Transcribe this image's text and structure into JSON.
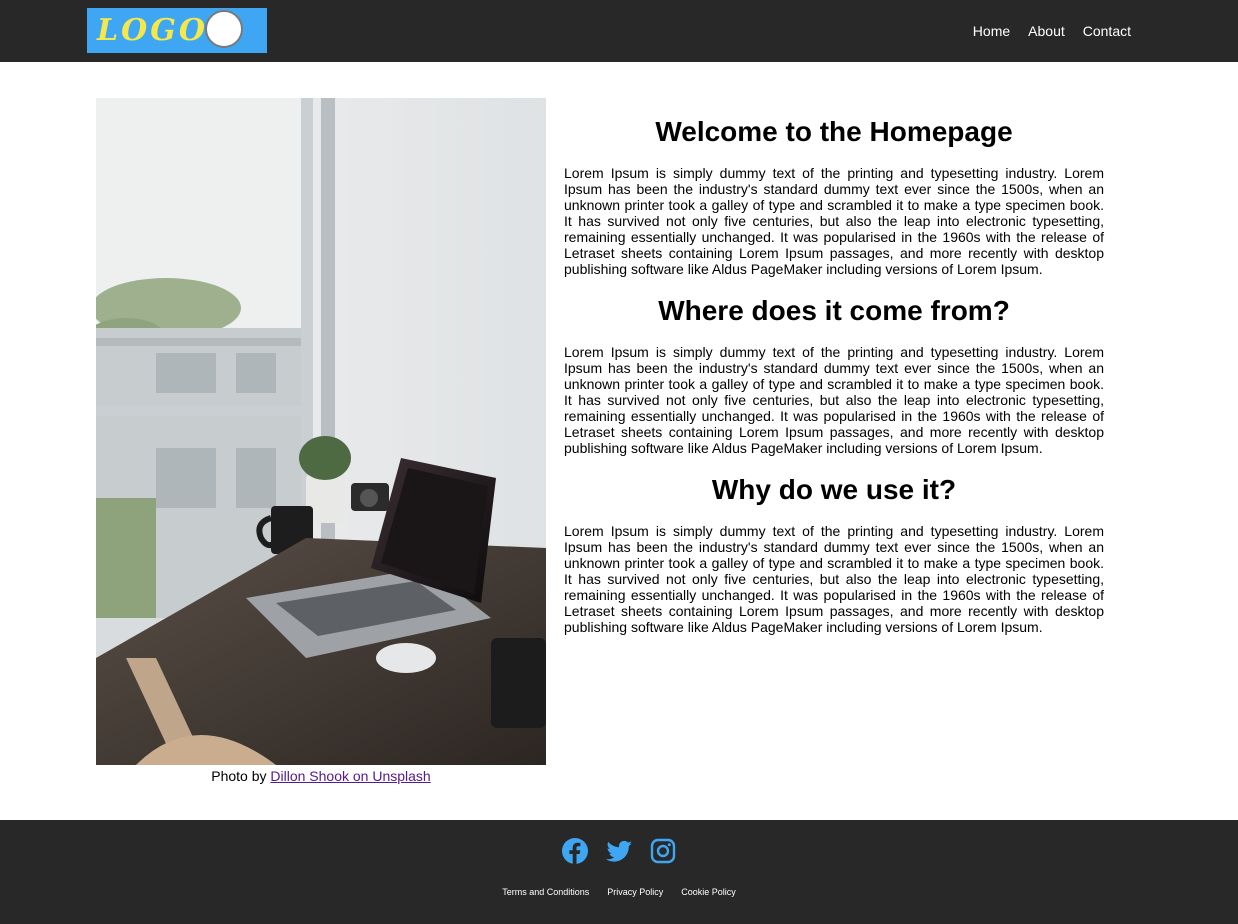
{
  "header": {
    "logo_text": "LOGO",
    "nav": [
      "Home",
      "About",
      "Contact"
    ]
  },
  "photo": {
    "caption_prefix": "Photo by ",
    "caption_link": "Dillon Shook on Unsplash"
  },
  "sections": [
    {
      "title": "Welcome to the Homepage",
      "body": "Lorem Ipsum is simply dummy text of the printing and typesetting industry. Lorem Ipsum has been the industry's standard dummy text ever since the 1500s, when an unknown printer took a galley of type and scrambled it to make a type specimen book. It has survived not only five centuries, but also the leap into electronic typesetting, remaining essentially unchanged. It was popularised in the 1960s with the release of Letraset sheets containing Lorem Ipsum passages, and more recently with desktop publishing software like Aldus PageMaker including versions of Lorem Ipsum."
    },
    {
      "title": "Where does it come from?",
      "body": "Lorem Ipsum is simply dummy text of the printing and typesetting industry. Lorem Ipsum has been the industry's standard dummy text ever since the 1500s, when an unknown printer took a galley of type and scrambled it to make a type specimen book. It has survived not only five centuries, but also the leap into electronic typesetting, remaining essentially unchanged. It was popularised in the 1960s with the release of Letraset sheets containing Lorem Ipsum passages, and more recently with desktop publishing software like Aldus PageMaker including versions of Lorem Ipsum."
    },
    {
      "title": "Why do we use it?",
      "body": "Lorem Ipsum is simply dummy text of the printing and typesetting industry. Lorem Ipsum has been the industry's standard dummy text ever since the 1500s, when an unknown printer took a galley of type and scrambled it to make a type specimen book. It has survived not only five centuries, but also the leap into electronic typesetting, remaining essentially unchanged. It was popularised in the 1960s with the release of Letraset sheets containing Lorem Ipsum passages, and more recently with desktop publishing software like Aldus PageMaker including versions of Lorem Ipsum."
    }
  ],
  "footer": {
    "social_icons": [
      "facebook-icon",
      "twitter-icon",
      "instagram-icon"
    ],
    "links": [
      "Terms and Conditions",
      "Privacy Policy",
      "Cookie Policy"
    ]
  },
  "colors": {
    "header_bg": "#282828",
    "footer_bg": "#282828",
    "logo_bg": "#3ea6f2",
    "logo_text": "#f6e84a",
    "social_icon": "#3ea6f2",
    "visited_link": "#551a8b"
  }
}
